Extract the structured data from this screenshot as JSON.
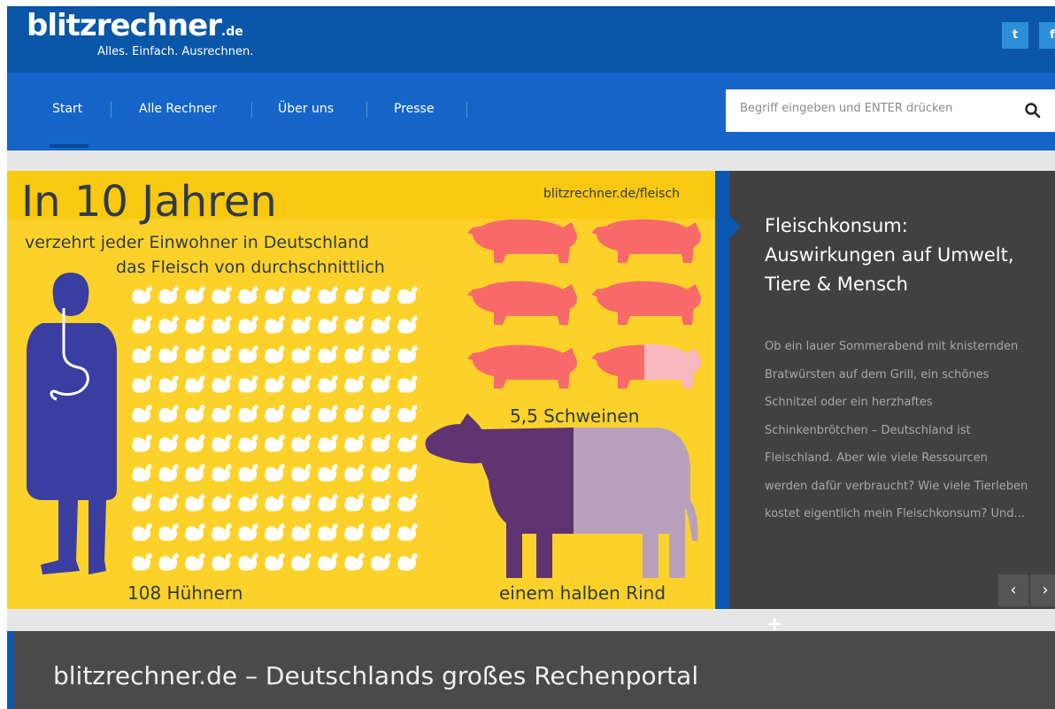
{
  "header": {
    "logo_text": "blitzrechner",
    "logo_tld": ".de",
    "tagline": "Alles. Einfach. Ausrechnen.",
    "social": [
      {
        "icon": "twitter-icon",
        "glyph": "t"
      },
      {
        "icon": "facebook-icon",
        "glyph": "f"
      }
    ]
  },
  "nav": {
    "items": [
      "Start",
      "Alle Rechner",
      "Über uns",
      "Presse"
    ]
  },
  "search": {
    "placeholder": "Begriff eingeben und ENTER drücken",
    "icon": "search-icon"
  },
  "infographic": {
    "title": "In 10 Jahren",
    "source": "blitzrechner.de/fleisch",
    "subtitle_line1": "verzehrt jeder Einwohner in Deutschland",
    "subtitle_line2": "das Fleisch von durchschnittlich",
    "chickens_label": "108 Hühnern",
    "pigs_label": "5,5 Schweinen",
    "cow_label": "einem halben Rind",
    "colors": {
      "background": "#fcd22a",
      "person": "#3a3ea1",
      "chicken": "#ffffff",
      "pig": "#f86a6a",
      "pig_half": "#f8b8c0",
      "cow_dark": "#5f3470",
      "cow_light": "#b8a0bd"
    }
  },
  "article": {
    "title": "Fleischkonsum: Auswirkungen auf Umwelt, Tiere & Mensch",
    "body": "Ob ein lauer Sommerabend mit knisternden Bratwürsten auf dem Grill, ein schönes Schnitzel oder ein herzhaftes Schinkenbrötchen – Deutschland ist Fleischland. Aber wie viele Ressourcen werden dafür verbraucht? Wie viele Tierleben kostet eigentlich mein Fleischkonsum? Und...",
    "prev_glyph": "‹",
    "next_glyph": "›"
  },
  "footer": {
    "title": "blitzrechner.de – Deutschlands großes Rechenportal"
  }
}
